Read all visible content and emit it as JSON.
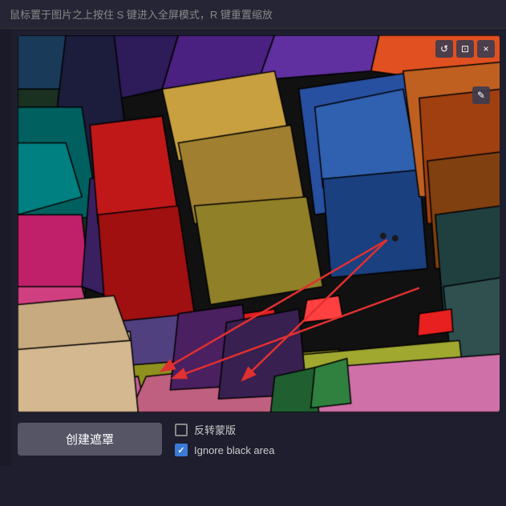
{
  "header": {
    "instruction": "鼠标置于图片之上按住 S 键进入全屏模式，R 键重置缩放"
  },
  "toolbar": {
    "create_btn_label": "创建遮罩",
    "reverse_label": "反转蒙版",
    "ignore_black_label": "Ignore black area"
  },
  "image_controls": {
    "reset_icon": "↺",
    "close_icon": "×",
    "edit_icon": "✎"
  },
  "checkboxes": {
    "reverse": {
      "checked": false,
      "label": "反转蒙版"
    },
    "ignore_black": {
      "checked": true,
      "label": "Ignore black area"
    }
  },
  "colors": {
    "bg": "#1e1e2e",
    "topbar": "#252535",
    "button_bg": "#555566",
    "checkbox_checked": "#3a7bd5",
    "accent_red": "#e03030"
  }
}
